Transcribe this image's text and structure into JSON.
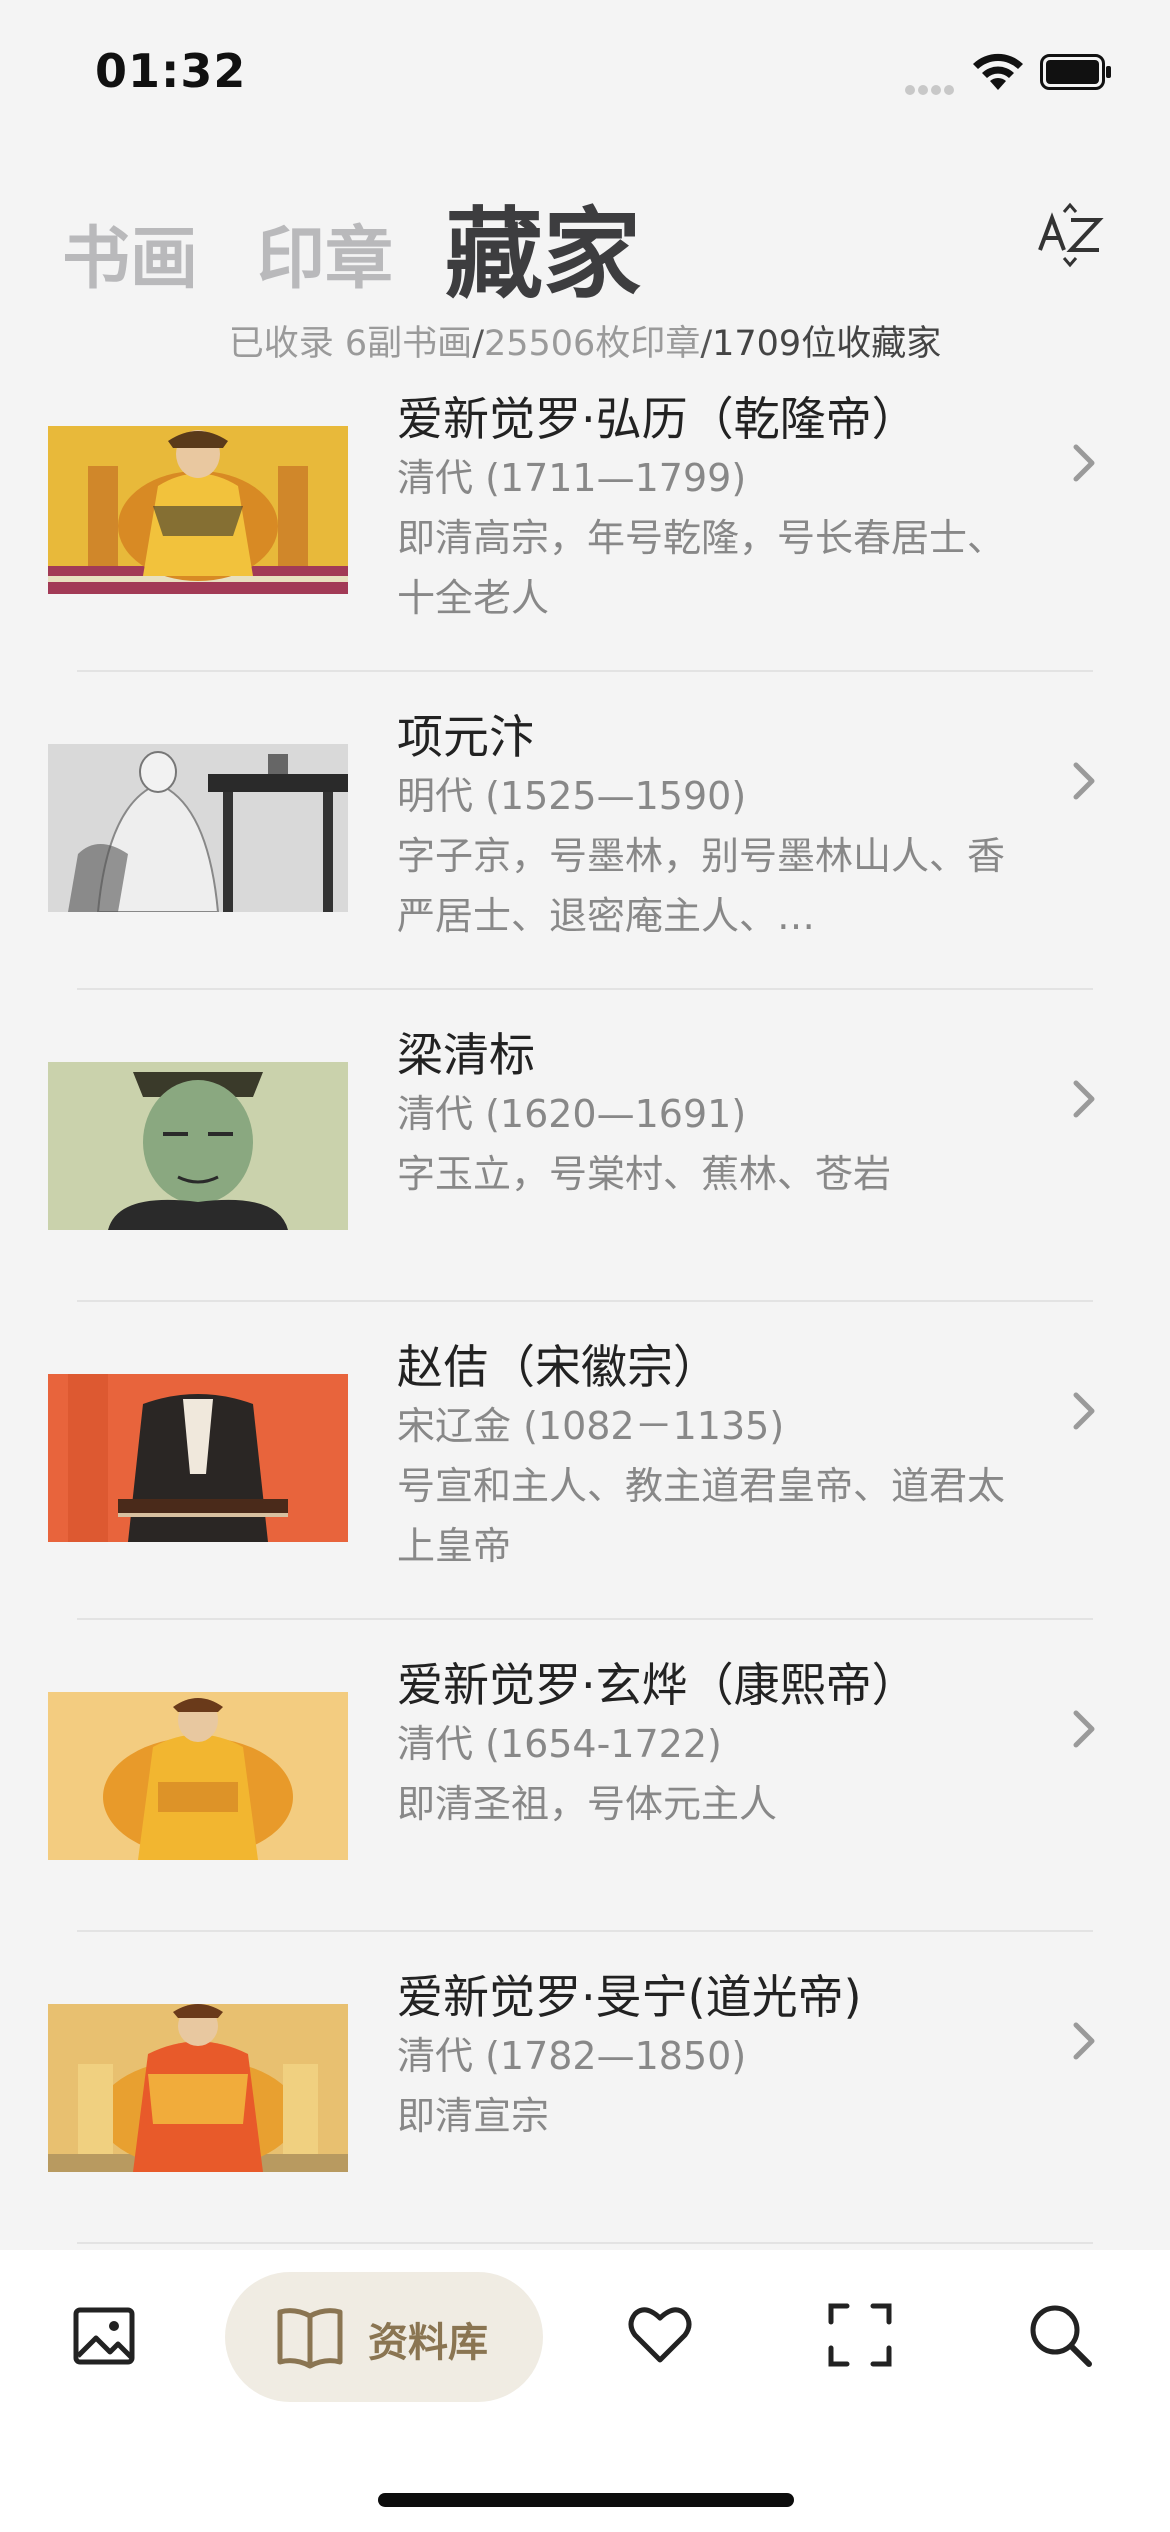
{
  "status_bar": {
    "time": "01:32"
  },
  "header": {
    "tabs": [
      {
        "label": "书画",
        "active": false
      },
      {
        "label": "印章",
        "active": false
      },
      {
        "label": "藏家",
        "active": true
      }
    ],
    "sort_icon": "az-sort-icon"
  },
  "stats": {
    "part1": "已收录 6副书画",
    "sep1": "/",
    "part2": "25506枚印章",
    "sep2": "/",
    "part3": "1709位收藏家"
  },
  "collectors": [
    {
      "name": "爱新觉罗·弘历（乾隆帝）",
      "era": "清代 (1711—1799)",
      "desc": "即清高宗，年号乾隆，号长春居士、十全老人"
    },
    {
      "name": "项元汴",
      "era": "明代 (1525—1590)",
      "desc": "字子京，号墨林，别号墨林山人、香严居士、退密庵主人、…"
    },
    {
      "name": "梁清标",
      "era": "清代 (1620—1691)",
      "desc": "字玉立，号棠村、蕉林、苍岩"
    },
    {
      "name": "赵佶（宋徽宗）",
      "era": "宋辽金 (1082－1135)",
      "desc": "号宣和主人、教主道君皇帝、道君太上皇帝"
    },
    {
      "name": "爱新觉罗·玄烨（康熙帝）",
      "era": "清代 (1654-1722)",
      "desc": "即清圣祖，号体元主人"
    },
    {
      "name": "爱新觉罗·旻宁(道光帝)",
      "era": "清代 (1782—1850)",
      "desc": "即清宣宗"
    }
  ],
  "tabbar": {
    "items": [
      {
        "icon": "gallery-icon"
      },
      {
        "icon": "book-icon",
        "label": "资料库",
        "active": true
      },
      {
        "icon": "heart-icon"
      },
      {
        "icon": "scan-icon"
      },
      {
        "icon": "search-icon"
      }
    ]
  },
  "colors": {
    "accent": "#8a7552",
    "pill": "#f0ece3",
    "background": "#f4f4f4"
  }
}
